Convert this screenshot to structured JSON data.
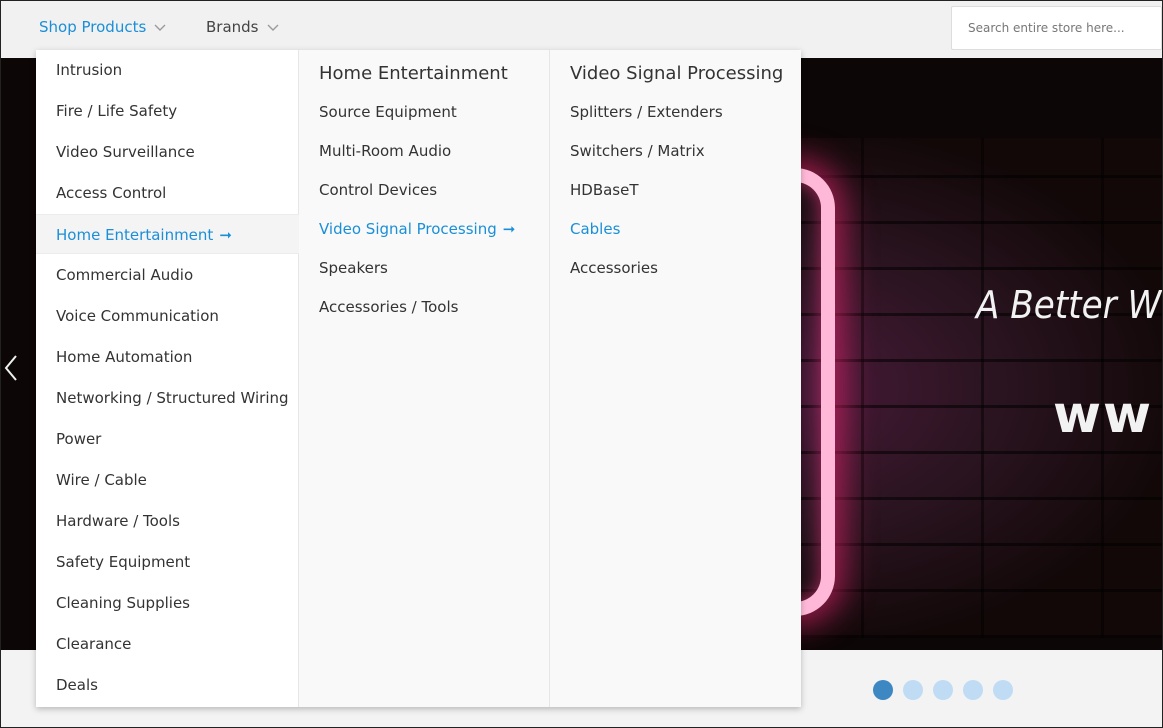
{
  "nav": {
    "shop_label": "Shop Products",
    "brands_label": "Brands",
    "search_placeholder": "Search entire store here..."
  },
  "menu": {
    "categories": [
      {
        "label": "Intrusion"
      },
      {
        "label": "Fire / Life Safety"
      },
      {
        "label": "Video Surveillance"
      },
      {
        "label": "Access Control"
      },
      {
        "label": "Home Entertainment",
        "active": true
      },
      {
        "label": "Commercial Audio"
      },
      {
        "label": "Voice Communication"
      },
      {
        "label": "Home Automation"
      },
      {
        "label": "Networking / Structured Wiring"
      },
      {
        "label": "Power"
      },
      {
        "label": "Wire / Cable"
      },
      {
        "label": "Hardware / Tools"
      },
      {
        "label": "Safety Equipment"
      },
      {
        "label": "Cleaning Supplies"
      },
      {
        "label": "Clearance"
      },
      {
        "label": "Deals"
      }
    ],
    "sub": {
      "heading": "Home Entertainment",
      "items": [
        {
          "label": "Source Equipment"
        },
        {
          "label": "Multi-Room Audio"
        },
        {
          "label": "Control Devices"
        },
        {
          "label": "Video Signal Processing",
          "active": true
        },
        {
          "label": "Speakers"
        },
        {
          "label": "Accessories / Tools"
        }
      ]
    },
    "subsub": {
      "heading": "Video Signal Processing",
      "items": [
        {
          "label": "Splitters / Extenders"
        },
        {
          "label": "Switchers / Matrix"
        },
        {
          "label": "HDBaseT"
        },
        {
          "label": "Cables",
          "active": true
        },
        {
          "label": "Accessories"
        }
      ]
    },
    "active_arrow": "➞"
  },
  "banner": {
    "tagline": "A Better W",
    "url_fragment": "ww",
    "slide_count": 5,
    "active_slide": 1
  },
  "colors": {
    "accent": "#1a8fd8",
    "dot_active": "#3d87c2",
    "dot_inactive": "#bfdcf4"
  },
  "icons": {
    "nav_dropdown": "chevron-down-icon",
    "banner_prev": "chevron-left-icon",
    "active_item": "arrow-right-icon"
  }
}
